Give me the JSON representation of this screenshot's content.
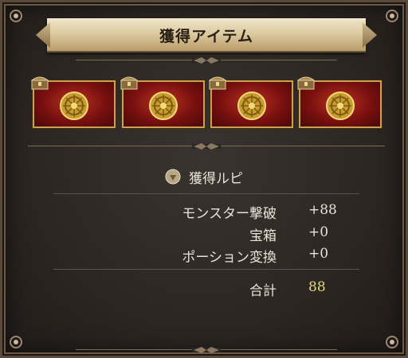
{
  "dialog": {
    "title": "獲得アイテム"
  },
  "items": [
    {
      "icon": "red-medal-card-icon",
      "badge": "treasure-chest-icon"
    },
    {
      "icon": "red-medal-card-icon",
      "badge": "treasure-chest-icon"
    },
    {
      "icon": "red-medal-card-icon",
      "badge": "treasure-chest-icon"
    },
    {
      "icon": "red-medal-card-icon",
      "badge": "treasure-chest-icon"
    }
  ],
  "rupi": {
    "label": "獲得ルピ",
    "icon": "rupi-coin-icon",
    "rows": [
      {
        "label": "モンスター撃破",
        "value": "+88"
      },
      {
        "label": "宝箱",
        "value": "+0"
      },
      {
        "label": "ポーション変換",
        "value": "+0"
      }
    ],
    "total_label": "合計",
    "total_value": "88"
  },
  "colors": {
    "total_value": "#e8d77a",
    "frame": "#6b5a46",
    "card_border": "#c9a24a"
  }
}
